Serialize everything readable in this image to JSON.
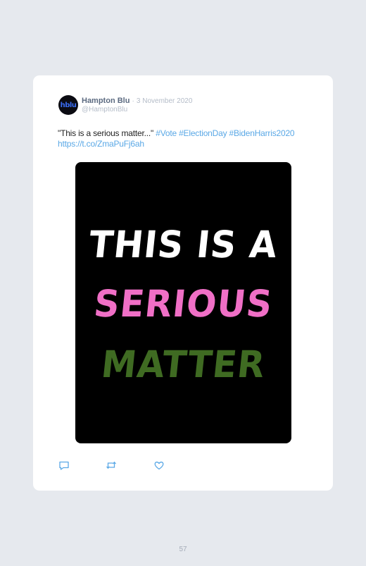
{
  "tweet": {
    "author_name": "Hampton Blu",
    "separator": "·",
    "date": "3 November 2020",
    "handle": "@HamptonBlu",
    "avatar_text": "hblu",
    "text_plain": "\"This is a serious matter...\" ",
    "hashtag_1": "#Vote",
    "hashtag_2": "#ElectionDay",
    "hashtag_3": "#BidenHarris2020",
    "link": "https://t.co/ZmaPuFj6ah",
    "media": {
      "line_1": "THIS IS A",
      "line_2": "SERIOUS",
      "line_3": "MATTER",
      "colors": {
        "line_1": "#ffffff",
        "line_2": "#f06fc6",
        "line_3": "#3f6b22",
        "background": "#000000"
      }
    },
    "actions": [
      {
        "icon": "reply-icon"
      },
      {
        "icon": "retweet-icon"
      },
      {
        "icon": "like-icon"
      }
    ]
  },
  "page_number": "57",
  "colors": {
    "page_background": "#e6e9ee",
    "card_background": "#ffffff",
    "link": "#5aa8e6",
    "name": "#5b6a80",
    "muted": "#b4bcc8"
  }
}
